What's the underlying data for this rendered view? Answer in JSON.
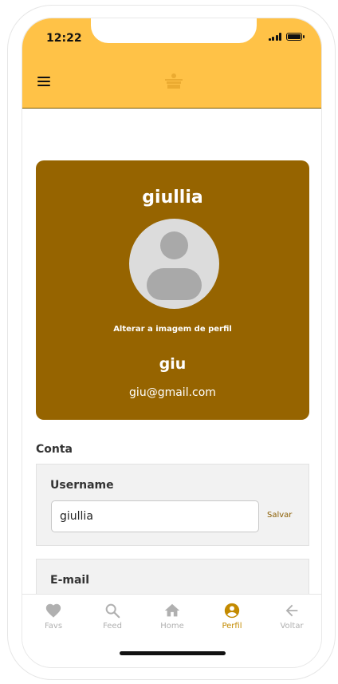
{
  "status_bar": {
    "time": "12:22"
  },
  "profile": {
    "name": "giullia",
    "change_photo_label": "Alterar a imagem de perfil",
    "nickname": "giu",
    "email": "giu@gmail.com"
  },
  "account": {
    "section_title": "Conta",
    "username_label": "Username",
    "username_value": "giullia",
    "save_label": "Salvar",
    "email_label": "E-mail"
  },
  "bottom_nav": {
    "items": [
      {
        "label": "Favs",
        "icon": "heart-icon"
      },
      {
        "label": "Feed",
        "icon": "search-icon"
      },
      {
        "label": "Home",
        "icon": "home-icon"
      },
      {
        "label": "Perfil",
        "icon": "account-circle-icon",
        "active": true
      },
      {
        "label": "Voltar",
        "icon": "arrow-back-icon"
      }
    ]
  },
  "colors": {
    "header": "#ffc247",
    "profile_card": "#966400",
    "active_nav": "#c38a00",
    "inactive_nav": "#b0b0b0"
  }
}
